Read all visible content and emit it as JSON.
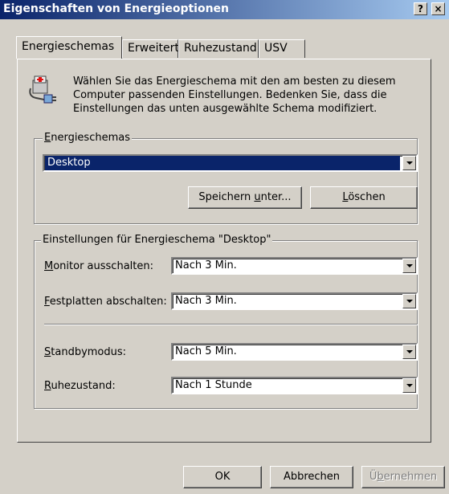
{
  "window": {
    "title": "Eigenschaften von Energieoptionen",
    "help": "?",
    "close": "×"
  },
  "tabs": [
    "Energieschemas",
    "Erweitert",
    "Ruhezustand",
    "USV"
  ],
  "intro": "Wählen Sie das Energieschema mit den am besten zu diesem Computer passenden Einstellungen. Bedenken Sie, dass die Einstellungen das unten ausgewählte Schema modifiziert.",
  "schemes": {
    "legend_ul": "E",
    "legend_rest": "nergieschemas",
    "selected": "Desktop",
    "save_pre": "Speichern ",
    "save_ul": "u",
    "save_post": "nter...",
    "delete_ul": "L",
    "delete_rest": "öschen"
  },
  "settings": {
    "legend": "Einstellungen für Energieschema \"Desktop\"",
    "rows": [
      {
        "ul": "M",
        "rest": "onitor ausschalten:",
        "value": "Nach 3 Min."
      },
      {
        "ul": "F",
        "rest": "estplatten abschalten:",
        "value": "Nach 3 Min."
      },
      {
        "ul": "S",
        "rest": "tandbymodus:",
        "value": "Nach 5 Min."
      },
      {
        "ul": "R",
        "rest": "uhezustand:",
        "value": "Nach 1 Stunde"
      }
    ]
  },
  "buttons": {
    "ok": "OK",
    "cancel": "Abbrechen",
    "apply_pre": "Ü",
    "apply_ul": "b",
    "apply_post": "ernehmen"
  }
}
